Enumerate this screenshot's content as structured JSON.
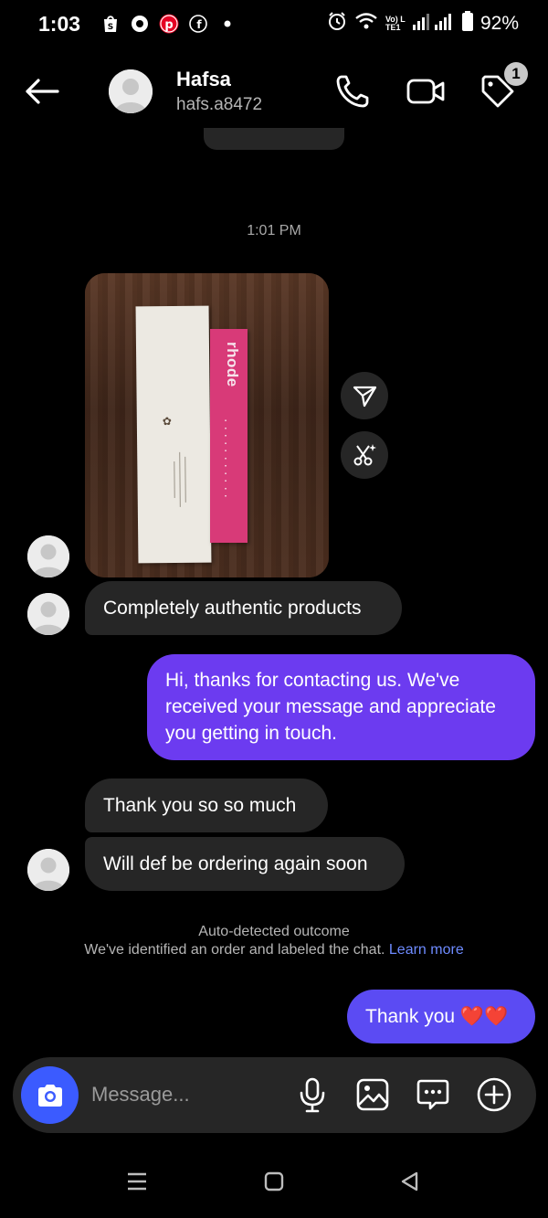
{
  "status_bar": {
    "time": "1:03",
    "battery": "92%",
    "network_label": "Vo) LTE1"
  },
  "header": {
    "name": "Hafsa",
    "handle": "hafs.a8472",
    "tag_badge_count": "1"
  },
  "thread": {
    "timestamp": "1:01 PM",
    "photo_product_brand": "rhode",
    "messages": [
      {
        "direction": "incoming",
        "text": "Completely authentic products"
      },
      {
        "direction": "outgoing",
        "text": "Hi, thanks for contacting us. We've received your message and appreciate you getting in touch."
      },
      {
        "direction": "incoming",
        "text": "Thank you so so much"
      },
      {
        "direction": "incoming",
        "text": "Will def be ordering again soon"
      },
      {
        "direction": "outgoing",
        "text": "Thank you ❤️❤️"
      }
    ],
    "outcome": {
      "title": "Auto-detected outcome",
      "body": "We've identified an order and labeled the chat.",
      "link": "Learn more"
    }
  },
  "composer": {
    "placeholder": "Message..."
  },
  "colors": {
    "background": "#000000",
    "incoming_bubble": "#262626",
    "outgoing_bubble": "#6c3bf0",
    "camera_button": "#3b5bff",
    "link": "#6e8bff"
  },
  "icons": {
    "status": [
      "shopify-icon",
      "circle-icon",
      "pinterest-icon",
      "facebook-icon",
      "dot-icon",
      "alarm-icon",
      "wifi-icon",
      "signal-icon",
      "battery-icon"
    ],
    "header": [
      "back-arrow-icon",
      "phone-icon",
      "video-icon",
      "tag-icon"
    ],
    "composer": [
      "camera-icon",
      "mic-icon",
      "gallery-icon",
      "sticker-icon",
      "plus-icon"
    ]
  }
}
